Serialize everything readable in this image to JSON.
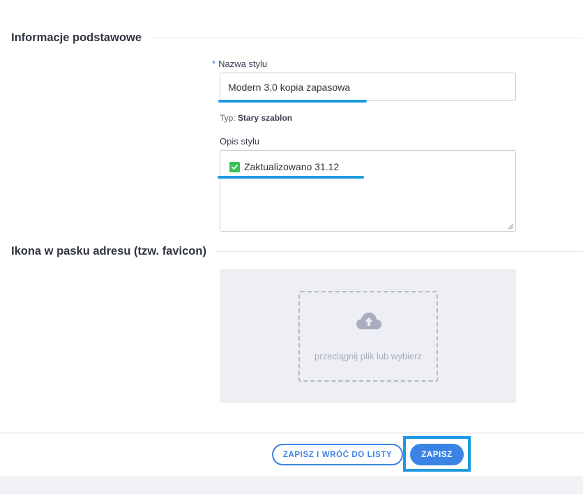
{
  "sections": {
    "basic_info": "Informacje podstawowe",
    "favicon": "Ikona w pasku adresu (tzw. favicon)"
  },
  "style_name": {
    "required_mark": "*",
    "label": "Nazwa stylu",
    "value": "Modern 3.0 kopia zapasowa"
  },
  "type_info": {
    "label": "Typ:",
    "value": "Stary szablon"
  },
  "description": {
    "label": "Opis stylu",
    "content": "Zaktualizowano 31.12"
  },
  "upload": {
    "hint": "przeciągnij plik lub wybierz"
  },
  "actions": {
    "save_and_return": "ZAPISZ I WRÓĆ DO LISTY",
    "save": "ZAPISZ"
  },
  "colors": {
    "accent": "#3b84e5",
    "annotation": "#1e9be0",
    "check": "#3cc05a"
  },
  "icons": [
    "check-icon",
    "cloud-upload-icon"
  ]
}
